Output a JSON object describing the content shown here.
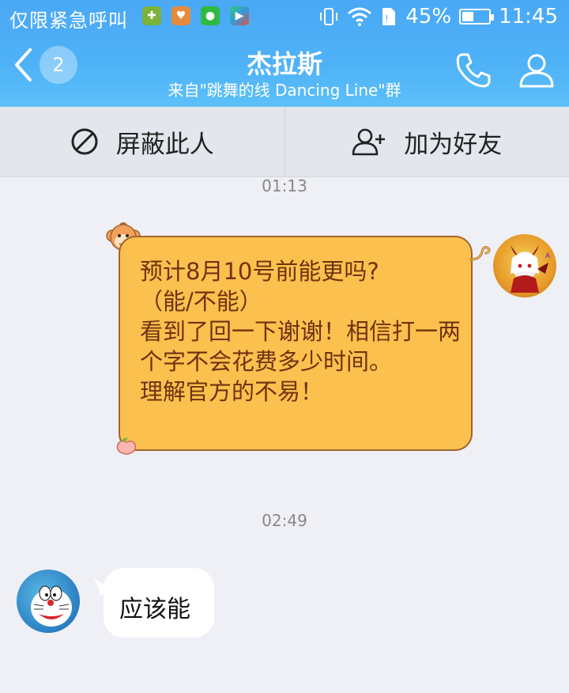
{
  "status_bar": {
    "carrier_text": "仅限紧急呼叫",
    "battery_level": "45%",
    "battery_fraction": 0.45,
    "time": "11:45",
    "app_icons": [
      "notification-app-green-icon",
      "notification-app-orange-icon",
      "wechat-icon",
      "play-store-icon"
    ]
  },
  "nav": {
    "back_badge": "2",
    "title": "杰拉斯",
    "subtitle": "来自\"跳舞的线  Dancing Line\"群"
  },
  "actions": {
    "block_label": "屏蔽此人",
    "add_friend_label": "加为好友"
  },
  "messages": [
    {
      "time": "01:13",
      "sender": "self",
      "text": "预计8月10号前能更吗?\n（能/不能）\n看到了回一下谢谢！相信打一两个字不会花费多少时间。\n理解官方的不易！"
    },
    {
      "time": "02:49",
      "sender": "other",
      "text": "应该能"
    }
  ],
  "colors": {
    "header_blue": "#4aa8f5",
    "bubble_yellow": "#fcc04e",
    "bubble_text": "#6f3310",
    "background": "#eff0f5"
  }
}
